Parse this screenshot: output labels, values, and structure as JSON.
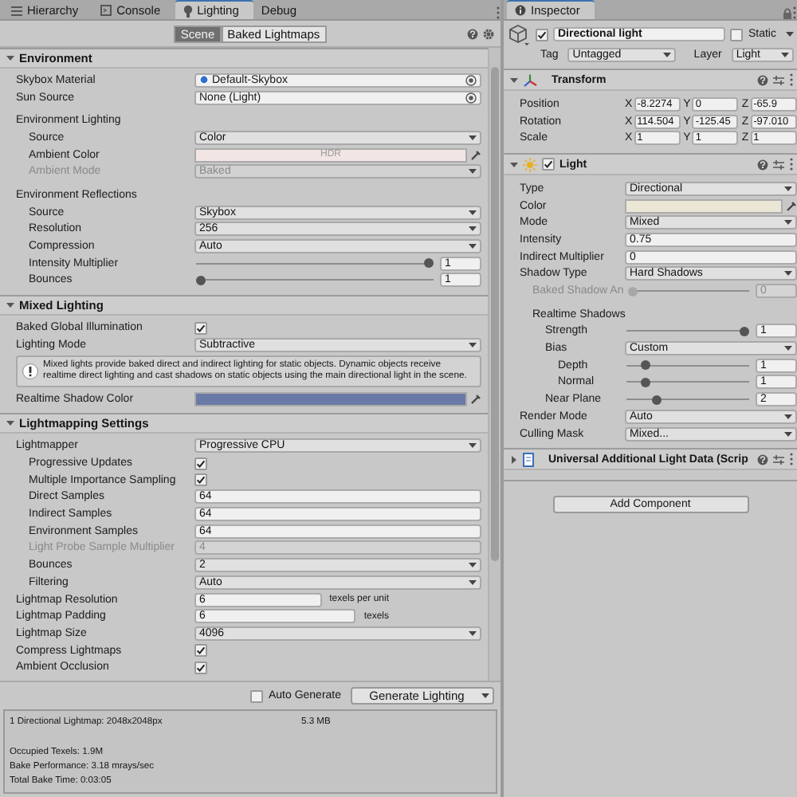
{
  "lighting": {
    "tabs": [
      {
        "label": "Hierarchy",
        "kind": "list",
        "selected": false
      },
      {
        "label": "Console",
        "kind": "console",
        "selected": false
      },
      {
        "label": "Lighting",
        "kind": "bulb",
        "selected": true
      },
      {
        "label": "Debug",
        "kind": "none",
        "selected": false
      }
    ],
    "modes": [
      {
        "label": "Scene",
        "selected": true
      },
      {
        "label": "Baked Lightmaps",
        "selected": false
      }
    ],
    "sections": [
      {
        "title": "Environment",
        "expanded": true,
        "rows": [
          {
            "kind": "object",
            "label": "Skybox Material",
            "value": "Default-Skybox",
            "asset": true,
            "disabled": false
          },
          {
            "kind": "object",
            "label": "Sun Source",
            "value": "None (Light)",
            "asset": false,
            "disabled": false
          },
          {
            "kind": "group",
            "label": "Environment Lighting",
            "disabled": false,
            "children": [
              {
                "kind": "dropdown",
                "label": "Source",
                "value": "Color",
                "disabled": false
              },
              {
                "kind": "color",
                "label": "Ambient Color",
                "color": "#f2e6e4",
                "badge": "HDR",
                "disabled": false
              },
              {
                "kind": "dropdown",
                "label": "Ambient Mode",
                "value": "Baked",
                "disabled": true
              }
            ]
          },
          {
            "kind": "group",
            "label": "Environment Reflections",
            "disabled": false,
            "children": [
              {
                "kind": "dropdown",
                "label": "Source",
                "value": "Skybox",
                "disabled": false
              },
              {
                "kind": "dropdown",
                "label": "Resolution",
                "value": "256",
                "disabled": false
              },
              {
                "kind": "dropdown",
                "label": "Compression",
                "value": "Auto",
                "disabled": false
              },
              {
                "kind": "slider",
                "label": "Intensity Multiplier",
                "level": 1,
                "value": "1",
                "disabled": false
              },
              {
                "kind": "slider",
                "label": "Bounces",
                "level": 0,
                "value": "1",
                "disabled": false
              }
            ]
          }
        ]
      },
      {
        "title": "Mixed Lighting",
        "expanded": true,
        "rows": [
          {
            "kind": "checkbox",
            "label": "Baked Global Illumination",
            "checked": true,
            "disabled": false
          },
          {
            "kind": "dropdown",
            "label": "Lighting Mode",
            "value": "Subtractive",
            "disabled": false
          },
          {
            "kind": "help",
            "text": "Mixed lights provide baked direct and indirect lighting for static objects. Dynamic objects receive realtime direct lighting and cast shadows on static objects using the main directional light in the scene."
          },
          {
            "kind": "color",
            "label": "Realtime Shadow Color",
            "color": "#6a7aa6",
            "disabled": false
          }
        ]
      },
      {
        "title": "Lightmapping Settings",
        "expanded": true,
        "rows": [
          {
            "kind": "dropdown",
            "label": "Lightmapper",
            "value": "Progressive CPU",
            "disabled": false,
            "children": [
              {
                "kind": "checkbox",
                "label": "Progressive Updates",
                "checked": true,
                "disabled": false
              },
              {
                "kind": "checkbox",
                "label": "Multiple Importance Sampling",
                "checked": true,
                "disabled": false
              },
              {
                "kind": "text",
                "label": "Direct Samples",
                "value": "64",
                "disabled": false
              },
              {
                "kind": "text",
                "label": "Indirect Samples",
                "value": "64",
                "disabled": false
              },
              {
                "kind": "text",
                "label": "Environment Samples",
                "value": "64",
                "disabled": false
              },
              {
                "kind": "text",
                "label": "Light Probe Sample Multiplier",
                "value": "4",
                "disabled": true
              },
              {
                "kind": "dropdown",
                "label": "Bounces",
                "value": "2",
                "disabled": false
              },
              {
                "kind": "dropdown",
                "label": "Filtering",
                "value": "Auto",
                "disabled": false
              }
            ]
          },
          {
            "kind": "text",
            "label": "Lightmap Resolution",
            "value": "6",
            "suffix": "texels per unit",
            "disabled": false
          },
          {
            "kind": "text",
            "label": "Lightmap Padding",
            "value": "6",
            "suffix": "texels",
            "disabled": false
          },
          {
            "kind": "dropdown",
            "label": "Lightmap Size",
            "value": "4096",
            "disabled": false
          },
          {
            "kind": "checkbox",
            "label": "Compress Lightmaps",
            "checked": true,
            "disabled": false
          },
          {
            "kind": "checkbox",
            "label": "Ambient Occlusion",
            "checked": true,
            "disabled": false
          }
        ]
      }
    ],
    "auto_generate": {
      "label": "Auto Generate",
      "checked": false
    },
    "generate_button": "Generate Lighting",
    "stats": {
      "lightmaps": [
        {
          "label": "1 Directional Lightmap: 2048x2048px",
          "size": "5.3 MB"
        }
      ],
      "lines": [
        "Occupied Texels: 1.9M",
        "Bake Performance: 3.18 mrays/sec",
        "Total Bake Time: 0:03:05"
      ]
    }
  },
  "inspector": {
    "tab": {
      "label": "Inspector",
      "kind": "info",
      "selected": true
    },
    "object": {
      "enabled": true,
      "name": "Directional light",
      "static_label": "Static",
      "static": false,
      "tag_label": "Tag",
      "tag": "Untagged",
      "layer_label": "Layer",
      "layer": "Light"
    },
    "components": [
      {
        "kind": "transform",
        "title": "Transform",
        "expanded": true,
        "rows": [
          {
            "kind": "vector",
            "label": "Position",
            "disabled": false,
            "axes": [
              {
                "axis": "X",
                "value": "-8.2274"
              },
              {
                "axis": "Y",
                "value": "0"
              },
              {
                "axis": "Z",
                "value": "-65.9"
              }
            ]
          },
          {
            "kind": "vector",
            "label": "Rotation",
            "disabled": false,
            "axes": [
              {
                "axis": "X",
                "value": "114.504"
              },
              {
                "axis": "Y",
                "value": "-125.45"
              },
              {
                "axis": "Z",
                "value": "-97.010"
              }
            ]
          },
          {
            "kind": "vector",
            "label": "Scale",
            "disabled": false,
            "axes": [
              {
                "axis": "X",
                "value": "1"
              },
              {
                "axis": "Y",
                "value": "1"
              },
              {
                "axis": "Z",
                "value": "1"
              }
            ]
          }
        ]
      },
      {
        "kind": "light",
        "title": "Light",
        "expanded": true,
        "enabled": true,
        "rows": [
          {
            "kind": "dropdown",
            "label": "Type",
            "value": "Directional",
            "disabled": false
          },
          {
            "kind": "color",
            "label": "Color",
            "color": "#ebe6d6",
            "disabled": false
          },
          {
            "kind": "dropdown",
            "label": "Mode",
            "value": "Mixed",
            "disabled": false
          },
          {
            "kind": "text",
            "label": "Intensity",
            "value": "0.75",
            "disabled": false
          },
          {
            "kind": "text",
            "label": "Indirect Multiplier",
            "value": "0",
            "disabled": false
          },
          {
            "kind": "dropdown",
            "label": "Shadow Type",
            "value": "Hard Shadows",
            "disabled": false,
            "children": [
              {
                "kind": "slider",
                "label": "Baked Shadow An",
                "level": 0,
                "value": "0",
                "disabled": true
              },
              {
                "kind": "group",
                "label": "Realtime Shadows",
                "disabled": false,
                "children": [
                  {
                    "kind": "slider",
                    "label": "Strength",
                    "level": 1,
                    "value": "1",
                    "disabled": false
                  },
                  {
                    "kind": "dropdown",
                    "label": "Bias",
                    "value": "Custom",
                    "disabled": false,
                    "children": [
                      {
                        "kind": "slider",
                        "label": "Depth",
                        "level": 0.12,
                        "value": "1",
                        "disabled": false
                      },
                      {
                        "kind": "slider",
                        "label": "Normal",
                        "level": 0.12,
                        "value": "1",
                        "disabled": false
                      }
                    ]
                  },
                  {
                    "kind": "slider",
                    "label": "Near Plane",
                    "level": 0.22,
                    "value": "2",
                    "disabled": false
                  }
                ]
              }
            ]
          },
          {
            "kind": "dropdown",
            "label": "Render Mode",
            "value": "Auto",
            "disabled": false
          },
          {
            "kind": "dropdown",
            "label": "Culling Mask",
            "value": "Mixed...",
            "disabled": false
          }
        ]
      },
      {
        "kind": "script",
        "title": "Universal Additional Light Data (Scrip",
        "expanded": false
      }
    ],
    "add_component": "Add Component"
  }
}
